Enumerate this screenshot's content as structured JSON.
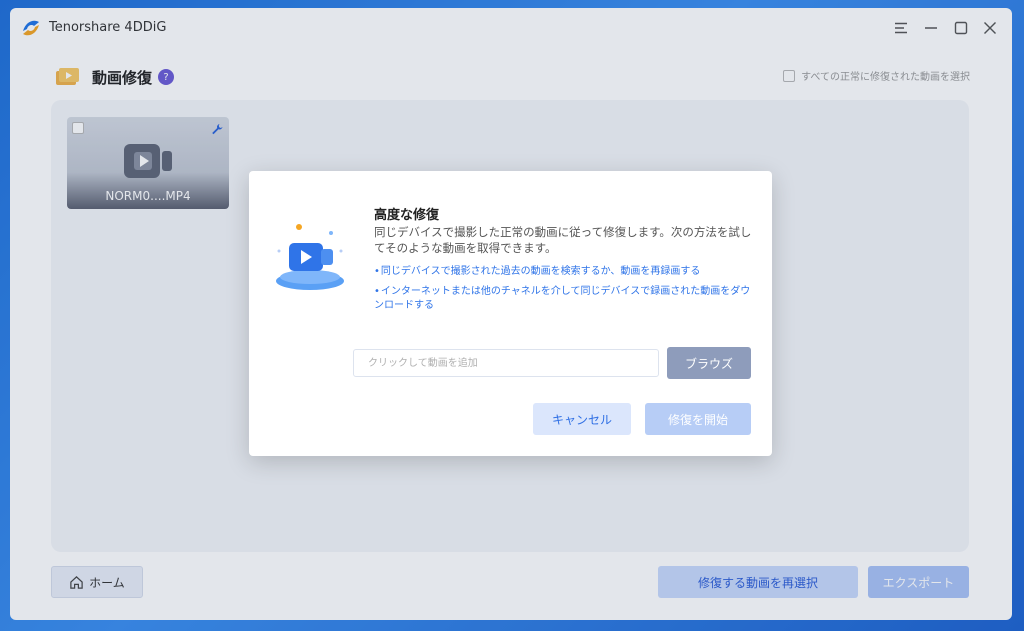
{
  "app": {
    "title": "Tenorshare 4DDiG"
  },
  "page": {
    "heading": "動画修復",
    "help_label": "?",
    "select_all_label": "すべての正常に修復された動画を選択"
  },
  "video_card": {
    "filename": "NORM0....MP4"
  },
  "footer": {
    "home_label": "ホーム",
    "reselect_label": "修復する動画を再選択",
    "export_label": "エクスポート"
  },
  "dialog": {
    "title": "高度な修復",
    "description": "同じデバイスで撮影した正常の動画に従って修復します。次の方法を試してそのような動画を取得できます。",
    "bullets": [
      "同じデバイスで撮影された過去の動画を検索するか、動画を再録画する",
      "インターネットまたは他のチャネルを介して同じデバイスで録画された動画をダウンロードする"
    ],
    "input_placeholder": "クリックして動画を追加",
    "browse_label": "ブラウズ",
    "cancel_label": "キャンセル",
    "start_label": "修復を開始"
  },
  "colors": {
    "accent": "#2f74e8",
    "help_badge": "#6b5bd6",
    "browse_button": "#8e9cbb",
    "start_button_disabled": "#b7cdf6",
    "cancel_button": "#dbe6fc"
  },
  "icons": {
    "app_logo": "4ddig-logo-icon",
    "menu": "menu-icon",
    "minimize": "minimize-icon",
    "maximize": "maximize-icon",
    "close": "close-icon",
    "heading": "video-repair-icon",
    "wrench": "wrench-icon",
    "video_camera": "video-camera-icon",
    "home": "home-icon",
    "illustration": "video-repair-illustration-icon"
  }
}
